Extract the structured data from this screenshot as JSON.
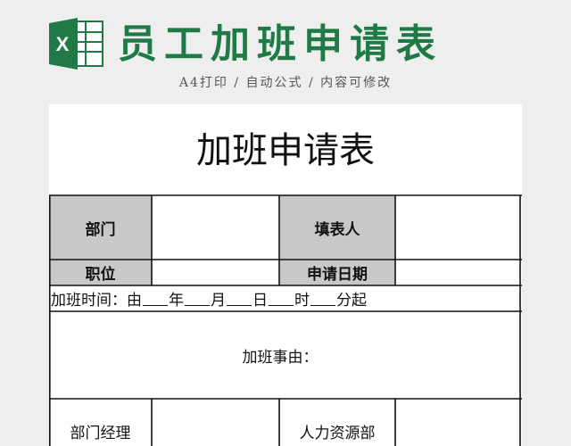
{
  "banner": {
    "title": "员工加班申请表",
    "subtitle": "A4打印 / 自动公式 / 内容可修改",
    "logo_letter": "X",
    "icon": "excel-icon",
    "brand_color": "#1f7a45"
  },
  "form": {
    "title": "加班申请表",
    "row1": {
      "label_a": "部门",
      "value_a": "",
      "label_b": "填表人",
      "value_b": ""
    },
    "row2": {
      "label_a": "职位",
      "value_a": "",
      "label_b": "申请日期",
      "value_b": ""
    },
    "time_line": {
      "prefix": "加班时间：由",
      "year": "年",
      "month": "月",
      "day": "日",
      "hour": "时",
      "minute": "分起"
    },
    "reason_label": "加班事由：",
    "row_sign": {
      "label_a": "部门经理",
      "value_a": "",
      "label_b": "人力资源部",
      "value_b": ""
    },
    "header_fill": "#c8c8c8"
  }
}
